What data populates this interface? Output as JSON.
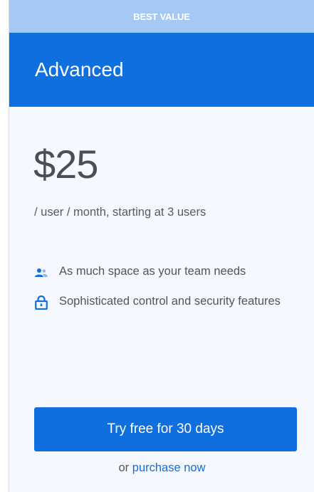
{
  "ribbon": {
    "label": "BEST VALUE"
  },
  "plan": {
    "name": "Advanced"
  },
  "pricing": {
    "amount": "$25",
    "subtext": "/ user / month, starting at 3 users"
  },
  "features": [
    {
      "icon": "team-icon",
      "text": "As much space as your team needs"
    },
    {
      "icon": "lock-icon",
      "text": "Sophisticated control and security features"
    }
  ],
  "cta": {
    "label": "Try free for 30 days"
  },
  "purchase": {
    "prefix": "or ",
    "link_label": "purchase now"
  },
  "colors": {
    "primary": "#0f6fde",
    "ribbon": "#a6c9f3",
    "card_bg": "#f5f9ff",
    "text": "#50565e"
  }
}
